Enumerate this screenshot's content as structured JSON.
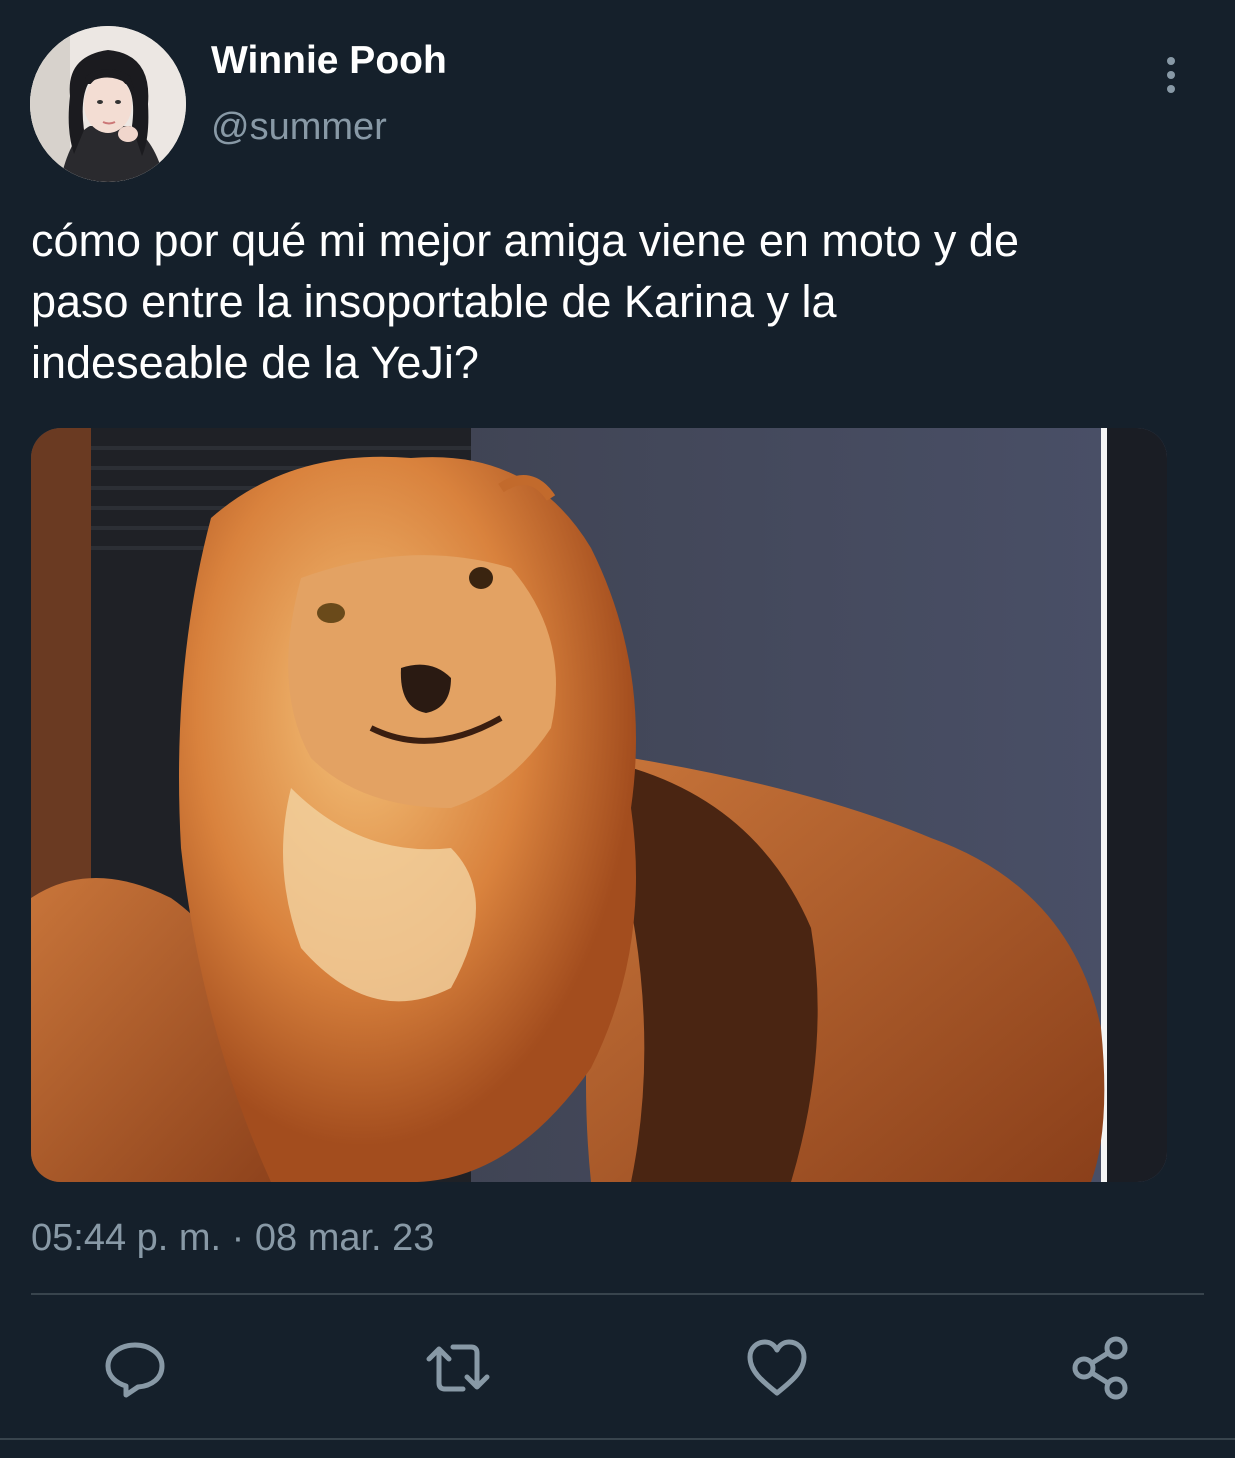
{
  "tweet": {
    "author_name": "Winnie Pooh",
    "author_handle": "@summer",
    "text": "cómo por qué mi mejor amiga viene en moto y de\npaso entre la insoportable de Karina y la\nindeseable de la YeJi?",
    "timestamp": "05:44 p. m. · 08 mar. 23"
  },
  "icons": {
    "more": "more-vertical-icon",
    "reply": "reply-icon",
    "retweet": "retweet-icon",
    "like": "heart-icon",
    "share": "share-icon"
  },
  "colors": {
    "background": "#15202b",
    "primary_text": "#ffffff",
    "secondary_text": "#8899a6",
    "divider": "#38444d"
  }
}
